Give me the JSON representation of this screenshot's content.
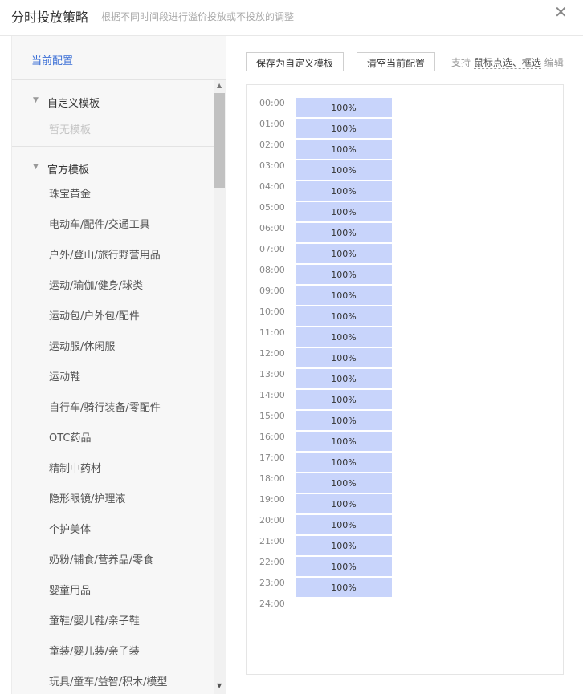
{
  "header": {
    "title": "分时投放策略",
    "subtitle": "根据不同时间段进行溢价投放或不投放的调整",
    "close_icon": "close-icon"
  },
  "sidebar": {
    "current_config": "当前配置",
    "custom_group": {
      "label": "自定义模板",
      "empty_text": "暂无模板"
    },
    "official_group": {
      "label": "官方模板",
      "items": [
        "珠宝黄金",
        "电动车/配件/交通工具",
        "户外/登山/旅行野营用品",
        "运动/瑜伽/健身/球类",
        "运动包/户外包/配件",
        "运动服/休闲服",
        "运动鞋",
        "自行车/骑行装备/零配件",
        "OTC药品",
        "精制中药材",
        "隐形眼镜/护理液",
        "个护美体",
        "奶粉/辅食/营养品/零食",
        "婴童用品",
        "童鞋/婴儿鞋/亲子鞋",
        "童装/婴儿装/亲子装",
        "玩具/童车/益智/积木/模型"
      ]
    }
  },
  "toolbar": {
    "save_label": "保存为自定义模板",
    "clear_label": "清空当前配置",
    "hint_prefix": "支持",
    "hint_emphasis": "鼠标点选、框选",
    "hint_suffix": "编辑"
  },
  "schedule": {
    "times": [
      "00:00",
      "01:00",
      "02:00",
      "03:00",
      "04:00",
      "05:00",
      "06:00",
      "07:00",
      "08:00",
      "09:00",
      "10:00",
      "11:00",
      "12:00",
      "13:00",
      "14:00",
      "15:00",
      "16:00",
      "17:00",
      "18:00",
      "19:00",
      "20:00",
      "21:00",
      "22:00",
      "23:00",
      "24:00"
    ],
    "values": [
      "100%",
      "100%",
      "100%",
      "100%",
      "100%",
      "100%",
      "100%",
      "100%",
      "100%",
      "100%",
      "100%",
      "100%",
      "100%",
      "100%",
      "100%",
      "100%",
      "100%",
      "100%",
      "100%",
      "100%",
      "100%",
      "100%",
      "100%",
      "100%"
    ]
  },
  "colors": {
    "accent": "#3b6fd6",
    "slot_fill": "#c8d4fb"
  }
}
